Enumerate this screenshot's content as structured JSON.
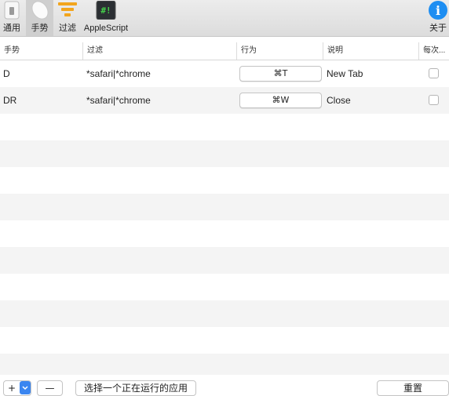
{
  "toolbar": {
    "items": [
      {
        "label": "通用",
        "icon": "switch-icon",
        "selected": false
      },
      {
        "label": "手势",
        "icon": "mouse-icon",
        "selected": true
      },
      {
        "label": "过滤",
        "icon": "filter-icon",
        "selected": false
      },
      {
        "label": "AppleScript",
        "icon": "script-editor-icon",
        "icon_text": "#!",
        "selected": false
      },
      {
        "label": "关于",
        "icon": "info-icon",
        "icon_text": "i",
        "selected": false
      }
    ]
  },
  "table": {
    "columns": [
      "手势",
      "过滤",
      "行为",
      "说明",
      "每次..."
    ],
    "rows": [
      {
        "gesture": "D",
        "filter": "*safari|*chrome",
        "action": "⌘T",
        "description": "New Tab",
        "every_time": false
      },
      {
        "gesture": "DR",
        "filter": "*safari|*chrome",
        "action": "⌘W",
        "description": "Close",
        "every_time": false
      }
    ]
  },
  "bottom": {
    "add_label": "+",
    "dropdown_icon": "chevron-down-icon",
    "remove_label": "—",
    "choose_app_label": "选择一个正在运行的应用",
    "reset_label": "重置"
  },
  "colors": {
    "accent": "#3b86f0",
    "filter_icon": "#f2a51e",
    "info_icon": "#1e8ef2",
    "script_icon_bg": "#2b2f33",
    "script_icon_text": "#45d14b"
  }
}
